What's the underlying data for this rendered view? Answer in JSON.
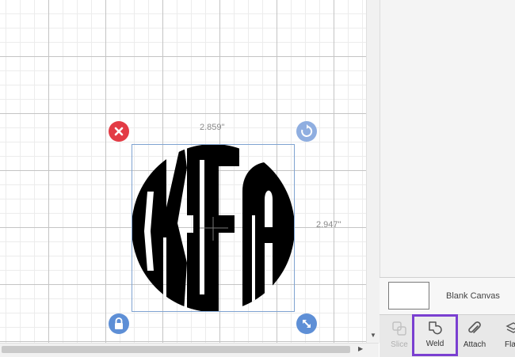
{
  "selection": {
    "width_label": "2.859\"",
    "height_label": "2.947\"",
    "handles": {
      "delete": "close-icon",
      "rotate": "rotate-icon",
      "lock": "lock-icon",
      "scale": "resize-icon"
    }
  },
  "design": {
    "letters": [
      "K",
      "F",
      "A"
    ],
    "fill_color": "#000000"
  },
  "layers_panel": {
    "canvas_label": "Blank Canvas"
  },
  "toolbar": {
    "items": [
      {
        "label": "Slice",
        "icon": "slice-icon",
        "enabled": false
      },
      {
        "label": "Weld",
        "icon": "weld-icon",
        "enabled": true,
        "highlighted": true
      },
      {
        "label": "Attach",
        "icon": "paperclip-icon",
        "enabled": true
      },
      {
        "label": "Fla",
        "icon": "flatten-icon",
        "enabled": true
      }
    ]
  },
  "colors": {
    "highlight": "#7a3fd1",
    "delete_handle": "#e33b45",
    "handle_blue": "#5e8fd6",
    "selection_border": "#7fa3d1"
  }
}
